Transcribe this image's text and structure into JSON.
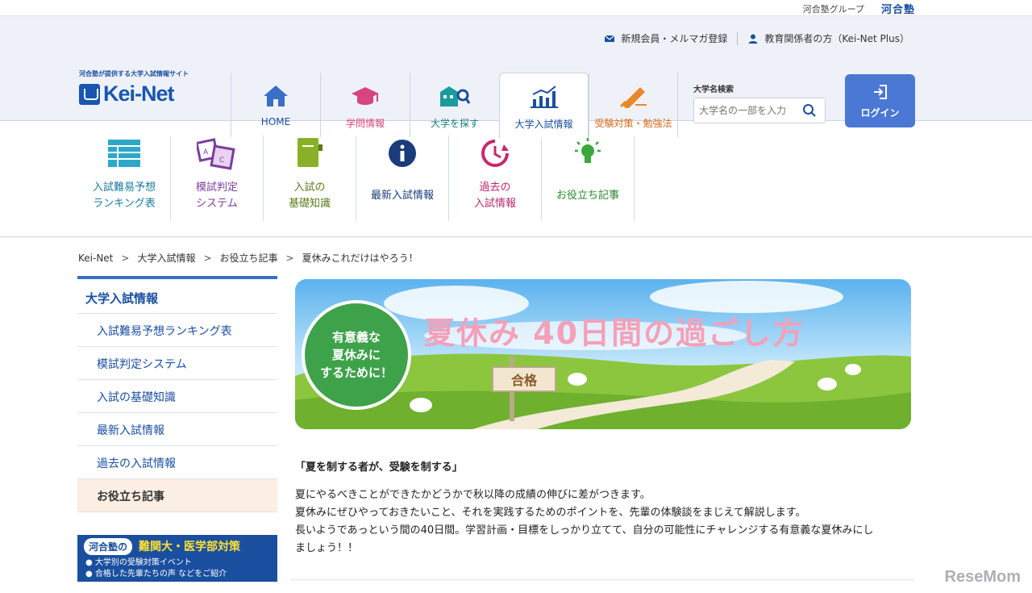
{
  "top": {
    "group_text": "河合塾グループ",
    "group_logo": "河合塾"
  },
  "util": {
    "register": "新規会員・メルマガ登録",
    "edu": "教育関係者の方（Kei-Net Plus）"
  },
  "logo": {
    "tagline": "河合塾が提供する大学入試情報サイト",
    "name": "Kei-Net"
  },
  "gnav": [
    {
      "label": "HOME",
      "color": "#1a4fa0"
    },
    {
      "label": "学問情報",
      "color": "#d6457d"
    },
    {
      "label": "大学を探す",
      "color": "#1a7c7c"
    },
    {
      "label": "大学入試情報",
      "color": "#1a4fa0"
    },
    {
      "label": "受験対策・勉強法",
      "color": "#d56a1a"
    }
  ],
  "search": {
    "label": "大学名検索",
    "placeholder": "大学名の一部を入力"
  },
  "login": {
    "label": "ログイン"
  },
  "subnav": [
    {
      "label": "入試難易予想\nランキング表",
      "color": "#1a7c9e"
    },
    {
      "label": "模試判定\nシステム",
      "color": "#7b3e9e"
    },
    {
      "label": "入試の\n基礎知識",
      "color": "#5a7a1a"
    },
    {
      "label": "最新入試情報",
      "color": "#1a3c7a"
    },
    {
      "label": "過去の\n入試情報",
      "color": "#b8286e"
    },
    {
      "label": "お役立ち記事",
      "color": "#2a8a2a"
    }
  ],
  "breadcrumb": [
    "Kei-Net",
    "大学入試情報",
    "お役立ち記事",
    "夏休みこれだけはやろう！"
  ],
  "sidebar": {
    "heading": "大学入試情報",
    "items": [
      "入試難易予想ランキング表",
      "模試判定システム",
      "入試の基礎知識",
      "最新入試情報",
      "過去の入試情報",
      "お役立ち記事"
    ]
  },
  "banner": {
    "pill": "河合塾の",
    "title": "難関大・医学部対策",
    "line1": "● 大学別の受験対策イベント",
    "line2": "● 合格した先輩たちの声 などをご紹介"
  },
  "hero": {
    "title": "夏休み 40日間の過ごし方",
    "circle": "有意義な\n夏休みに\nするために！",
    "sign": "合格"
  },
  "article": {
    "lead": "「夏を制する者が、受験を制する」",
    "body": "夏にやるべきことができたかどうかで秋以降の成績の伸びに差がつきます。\n夏休みにぜひやっておきたいこと、それを実践するためのポイントを、先輩の体験談をまじえて解説します。\n長いようであっという間の40日間。学習計画・目標をしっかり立てて、自分の可能性にチャレンジする有意義な夏休みにし\nましょう！！"
  },
  "watermark": "ReseMom"
}
